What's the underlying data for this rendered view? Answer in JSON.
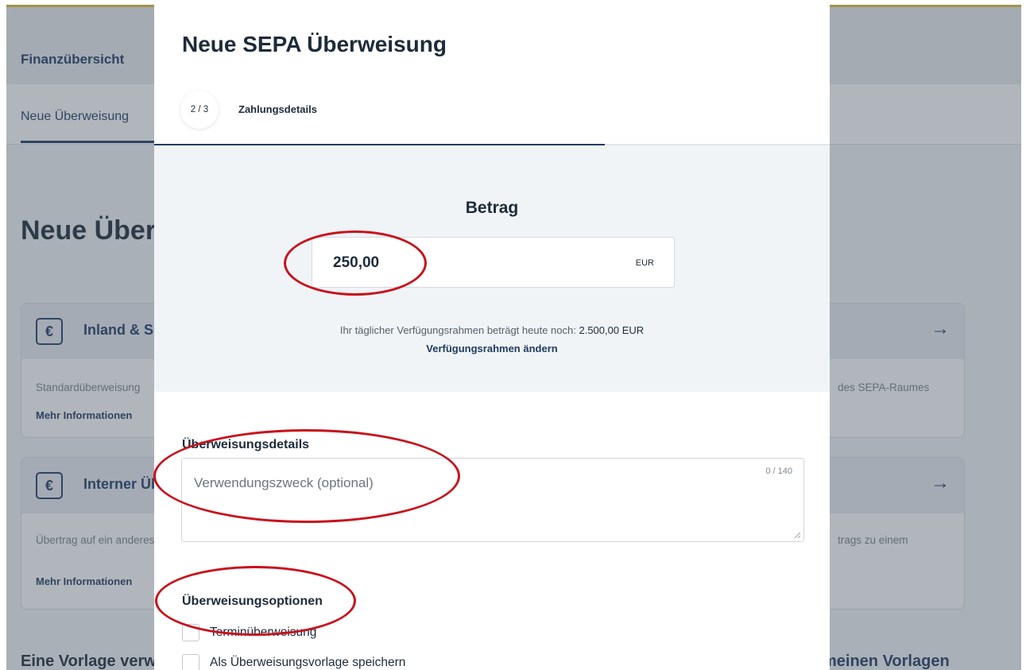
{
  "background": {
    "breadcrumb": "Finanzübersicht",
    "tab": "Neue Überweisung",
    "heading": "Neue Überweisung",
    "cards": [
      {
        "icon": "euro-transfer-icon",
        "title": "Inland & SEPA",
        "description_left": "Standardüberweisung",
        "description_right": "des SEPA-Raumes",
        "link": "Mehr Informationen"
      },
      {
        "icon": "euro-transfer-icon",
        "title": "Interner Übertrag",
        "description_left": "Übertrag auf ein anderes",
        "description_right": "trags zu einem",
        "link": "Mehr Informationen"
      }
    ],
    "bottom_left": "Eine Vorlage verwenden",
    "bottom_right": "meinen Vorlagen"
  },
  "modal": {
    "title": "Neue SEPA Überweisung",
    "step": {
      "indicator": "2 / 3",
      "label": "Zahlungsdetails",
      "progress": 0.667
    },
    "amount": {
      "title": "Betrag",
      "value": "250,00",
      "currency": "EUR",
      "limit_text": "Ihr täglicher Verfügungsrahmen beträgt heute noch:",
      "limit_value": "2.500,00 EUR",
      "limit_link": "Verfügungsrahmen ändern"
    },
    "details": {
      "heading": "Überweisungsdetails",
      "purpose_placeholder": "Verwendungszweck (optional)",
      "counter": "0 / 140"
    },
    "options": {
      "heading": "Überweisungsoptionen",
      "items": [
        "Terminüberweisung",
        "Als Überweisungsvorlage speichern"
      ]
    }
  },
  "colors": {
    "brand": "#1f3b63",
    "annotation": "#c8121c",
    "accent_top": "#e9c13a"
  }
}
